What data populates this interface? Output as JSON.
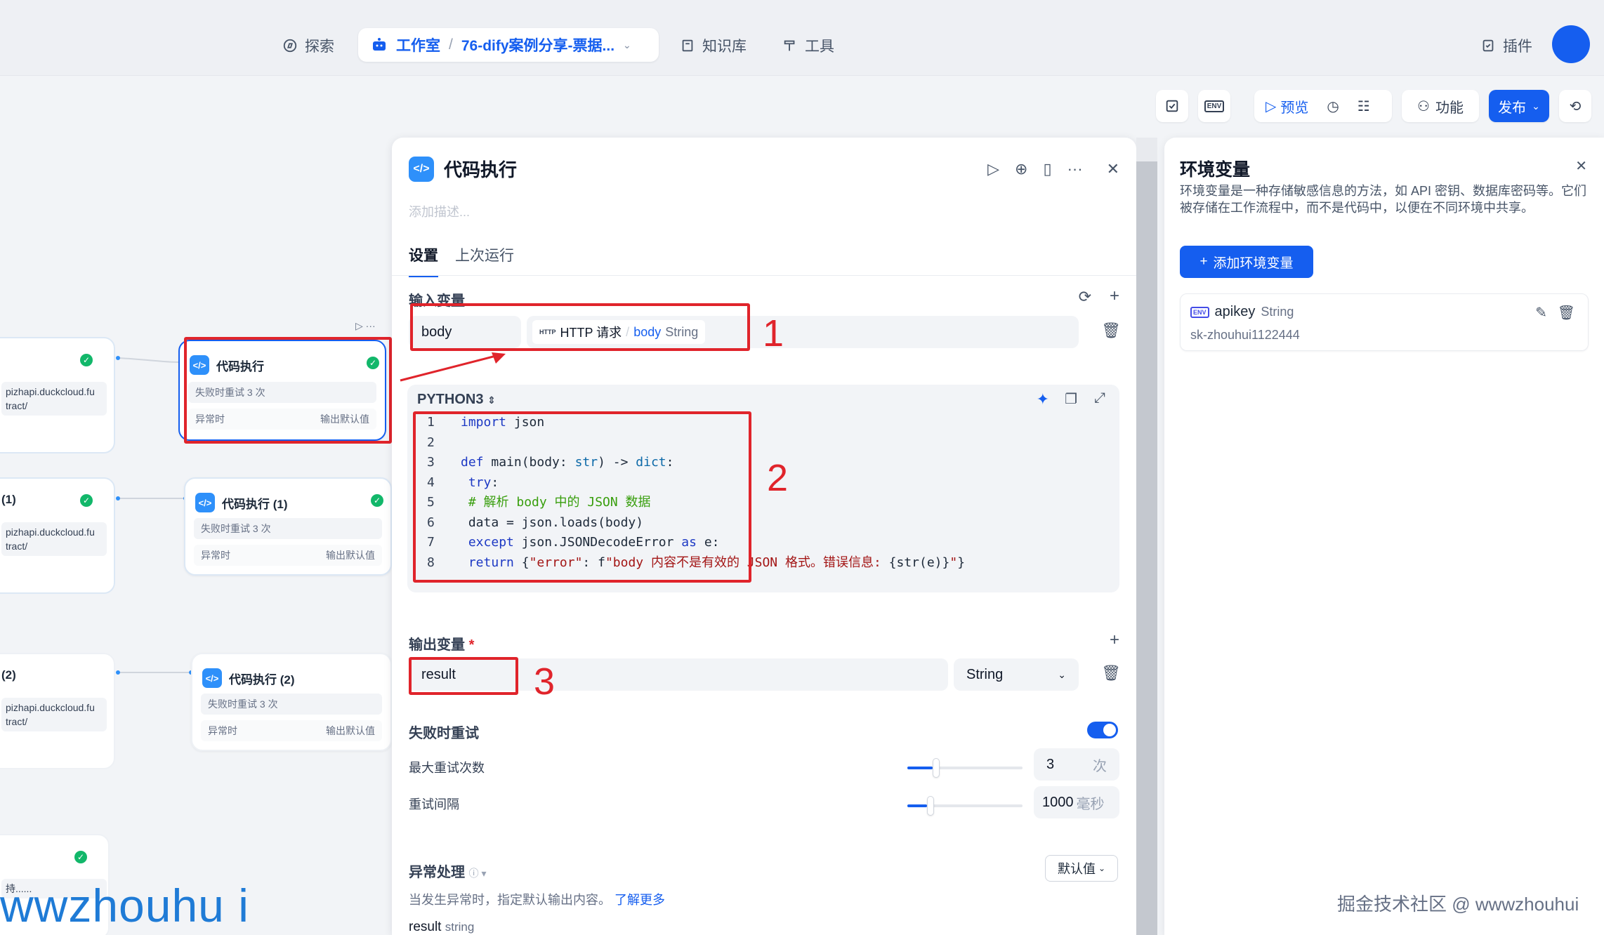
{
  "nav": {
    "explore": "探索",
    "studio": "工作室",
    "app_name": "76-dify案例分享-票据...",
    "knowledge": "知识库",
    "tools": "工具",
    "plugins": "插件"
  },
  "toolbar": {
    "env_badge": "ENV",
    "preview": "预览",
    "features": "功能",
    "publish": "发布"
  },
  "canvas": {
    "nodes": [
      {
        "title": "代码执行",
        "retry": "失败时重试 3 次",
        "on_error": "异常时",
        "error_value": "输出默认值"
      },
      {
        "title": "代码执行 (1)",
        "retry": "失败时重试 3 次",
        "on_error": "异常时",
        "error_value": "输出默认值"
      },
      {
        "title": "代码执行 (2)",
        "retry": "失败时重试 3 次",
        "on_error": "异常时",
        "error_value": "输出默认值"
      }
    ],
    "left_nodes": [
      {
        "title": "",
        "url": "pizhapi.duckcloud.fu\ntract/"
      },
      {
        "title": "(1)",
        "url": "pizhapi.duckcloud.fu\ntract/"
      },
      {
        "title": "(2)",
        "url": "pizhapi.duckcloud.fu\ntract/"
      },
      {
        "title": "",
        "url": "持......"
      }
    ],
    "annotations": [
      "1",
      "2",
      "3"
    ]
  },
  "panel": {
    "title": "代码执行",
    "desc_placeholder": "添加描述...",
    "tabs": [
      "设置",
      "上次运行"
    ],
    "input_vars_label": "输入变量",
    "input_var_name": "body",
    "input_var_source_badge": "HTTP",
    "input_var_source": "HTTP 请求",
    "input_var_field": "body",
    "input_var_type": "String",
    "code_lang": "PYTHON3",
    "output_vars_label": "输出变量",
    "required_mark": "*",
    "output_var_name": "result",
    "output_var_type": "String",
    "retry_label": "失败时重试",
    "retry_enabled": true,
    "max_retries_label": "最大重试次数",
    "max_retries": "3",
    "max_retries_unit": "次",
    "retry_interval_label": "重试间隔",
    "retry_interval": "1000",
    "retry_interval_unit": "毫秒",
    "error_handling_label": "异常处理",
    "error_handling_mode": "默认值",
    "error_help": "当发生异常时，指定默认输出内容。",
    "learn_more": "了解更多",
    "default_output_name": "result",
    "default_output_type": "string"
  },
  "env_panel": {
    "title": "环境变量",
    "description": "环境变量是一种存储敏感信息的方法，如 API 密钥、数据库密码等。它们被存储在工作流程中，而不是代码中，以便在不同环境中共享。",
    "add_button": "添加环境变量",
    "var_badge": "ENV",
    "var_name": "apikey",
    "var_type": "String",
    "var_value": "sk-zhouhui1122444"
  },
  "watermark": "wwzhouhu i",
  "watermark2": "掘金技术社区 @ wwwzhouhui",
  "colors": {
    "accent": "#155eef",
    "annotation": "#e0242b",
    "success": "#12b76a"
  }
}
